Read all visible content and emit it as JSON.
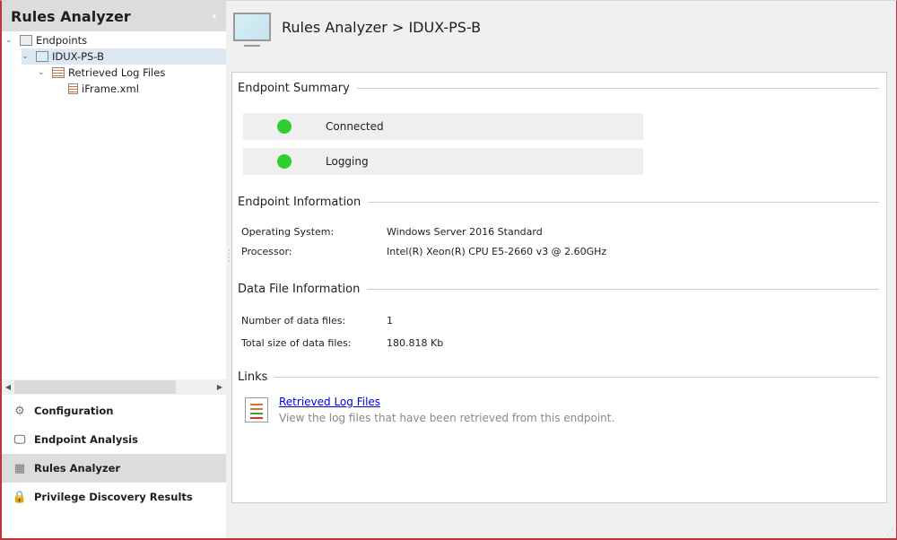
{
  "sidebar": {
    "title": "Rules Analyzer",
    "tree": [
      "Endpoints",
      "IDUX-PS-B",
      "Retrieved Log Files",
      "iFrame.xml"
    ],
    "nav": [
      "Configuration",
      "Endpoint Analysis",
      "Rules Analyzer",
      "Privilege Discovery Results"
    ]
  },
  "header": {
    "breadcrumb": "Rules Analyzer > IDUX-PS-B"
  },
  "summary": {
    "title": "Endpoint Summary",
    "items": [
      "Connected",
      "Logging"
    ],
    "status_color": "#2fcf2f"
  },
  "info": {
    "title": "Endpoint Information",
    "os_label": "Operating System:",
    "os": "Windows Server 2016 Standard",
    "cpu_label": "Processor:",
    "cpu": "Intel(R) Xeon(R) CPU E5-2660 v3 @ 2.60GHz"
  },
  "files": {
    "title": "Data File Information",
    "count_label": "Number of data files:",
    "count": "1",
    "size_label": "Total size of data files:",
    "size": "180.818 Kb"
  },
  "links": {
    "title": "Links",
    "link": "Retrieved Log Files",
    "desc": "View the log files that have been retrieved from this endpoint."
  }
}
